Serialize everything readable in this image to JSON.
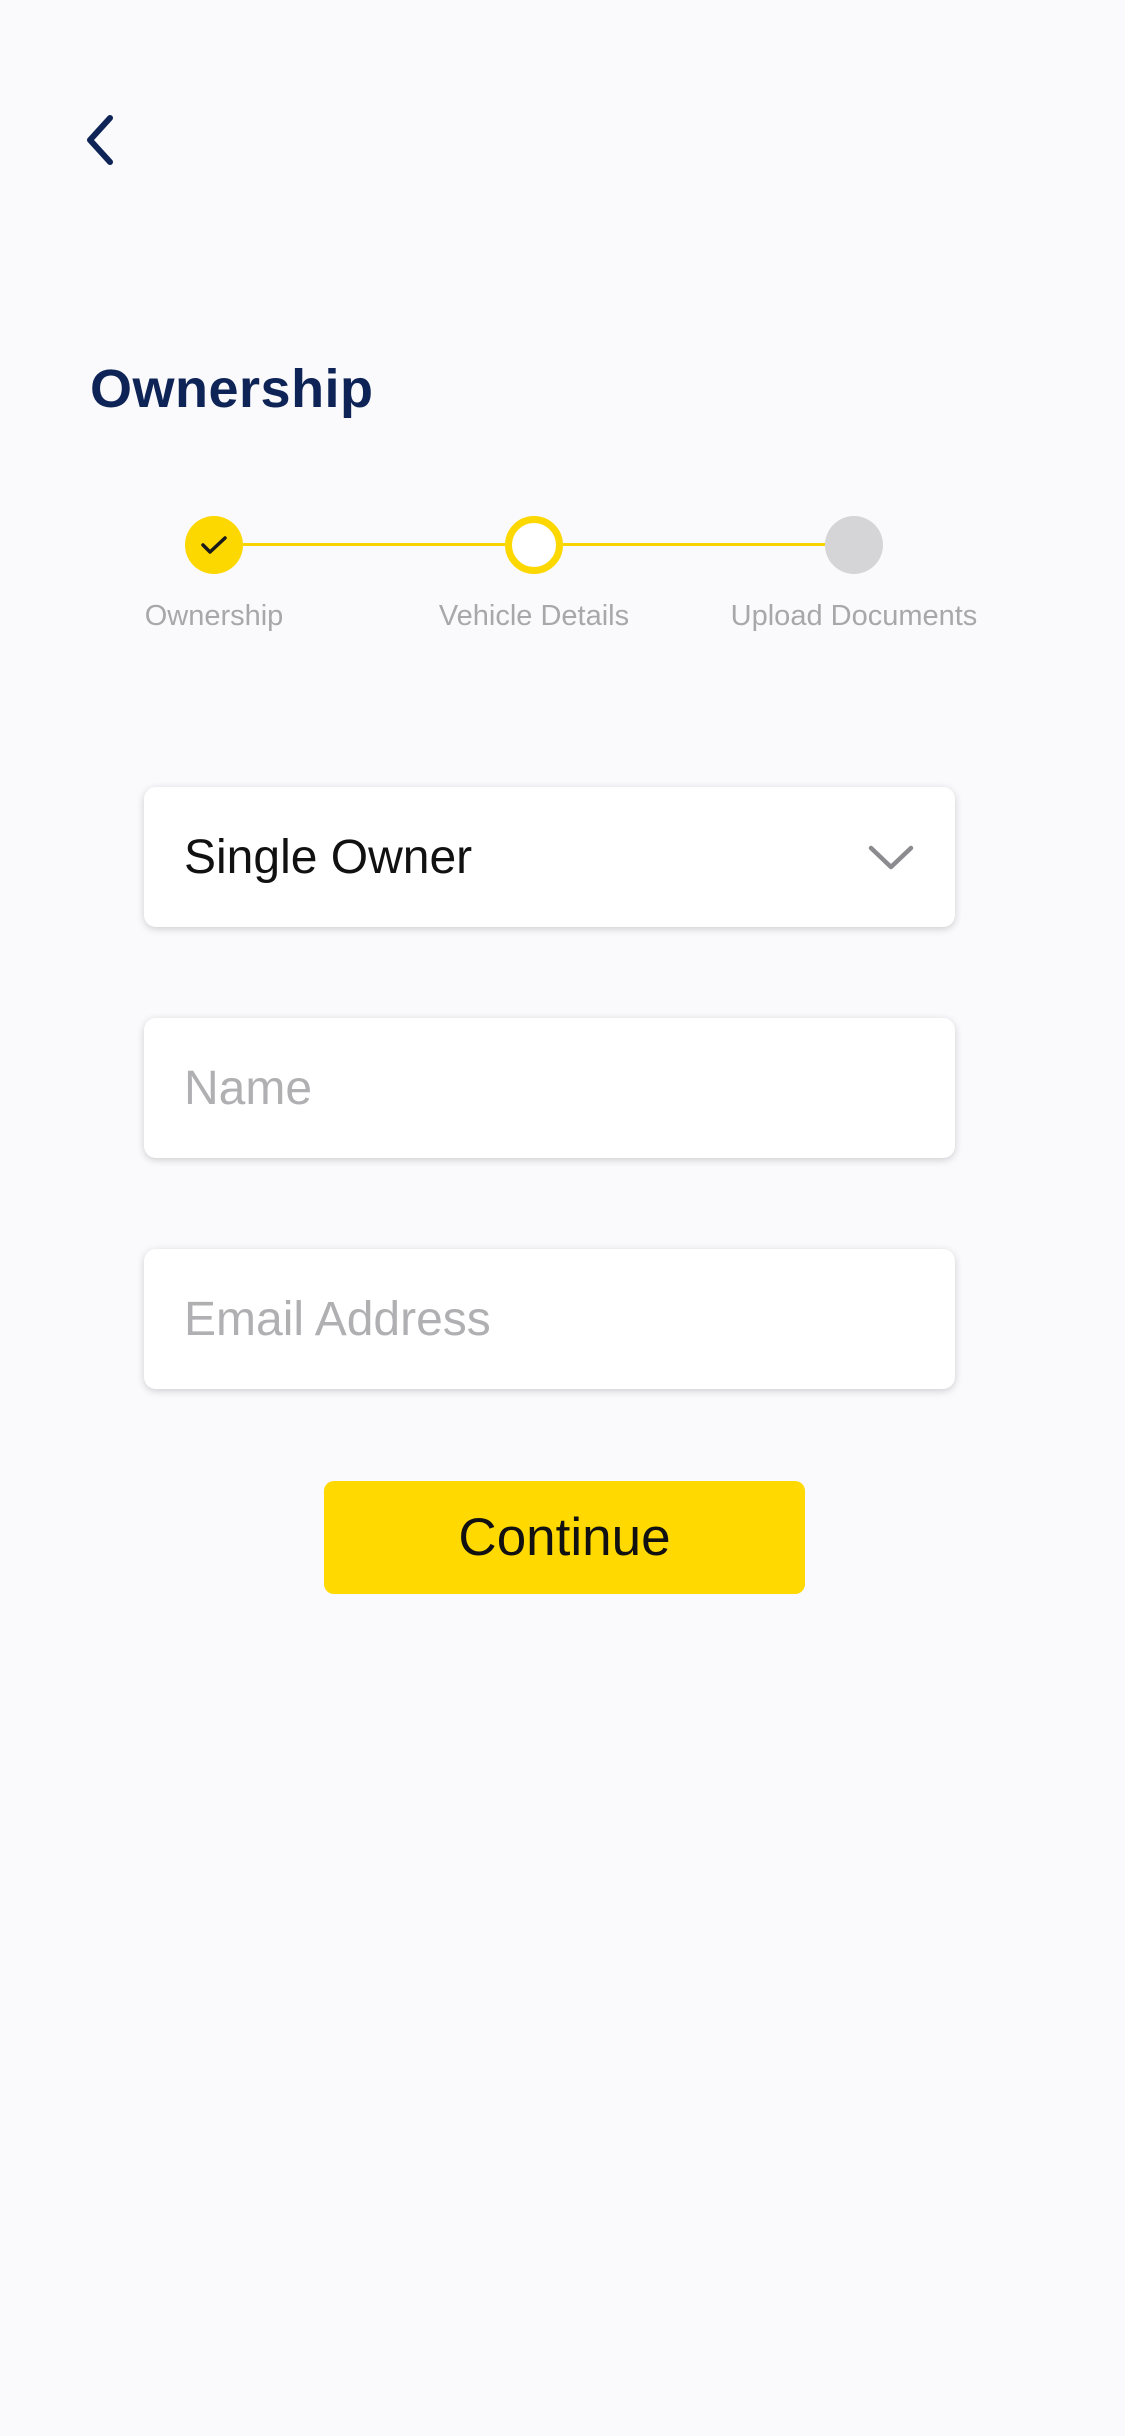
{
  "header": {
    "back_icon": "chevron-left-icon",
    "title": "Ownership"
  },
  "stepper": {
    "active_color": "#fcd800",
    "pending_color": "#d5d5d8",
    "steps": [
      {
        "label": "Ownership",
        "state": "done",
        "icon": "check-icon"
      },
      {
        "label": "Vehicle Details",
        "state": "current"
      },
      {
        "label": "Upload Documents",
        "state": "pending"
      }
    ]
  },
  "form": {
    "ownership_type": {
      "value": "Single Owner",
      "icon": "chevron-down-icon"
    },
    "name": {
      "value": "",
      "placeholder": "Name"
    },
    "email": {
      "value": "",
      "placeholder": "Email Address"
    },
    "continue_label": "Continue"
  },
  "colors": {
    "title": "#0e2457",
    "accent": "#ffd900",
    "background": "#fafafc"
  }
}
